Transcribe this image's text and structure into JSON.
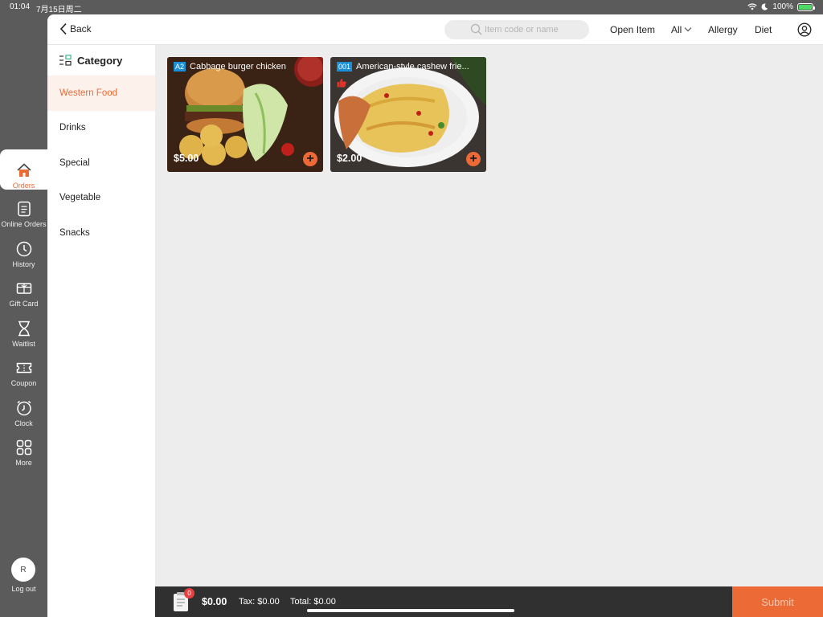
{
  "status_bar": {
    "time": "01:04",
    "date": "7月15日周二",
    "battery": "100%",
    "battery_level": 1.0
  },
  "rail": {
    "items": [
      {
        "label": "Orders",
        "icon": "house-icon",
        "active": true
      },
      {
        "label": "Online Orders",
        "icon": "document-icon"
      },
      {
        "label": "History",
        "icon": "clock-icon"
      },
      {
        "label": "Gift Card",
        "icon": "gift-card-icon"
      },
      {
        "label": "Waitlist",
        "icon": "hourglass-icon"
      },
      {
        "label": "Coupon",
        "icon": "ticket-icon"
      },
      {
        "label": "Clock",
        "icon": "alarm-icon"
      },
      {
        "label": "More",
        "icon": "grid-icon"
      }
    ],
    "avatar_initial": "R",
    "logout_label": "Log out"
  },
  "topbar": {
    "back_label": "Back",
    "search_placeholder": "Item code or name",
    "open_item": "Open Item",
    "filter_value": "All",
    "allergy": "Allergy",
    "diet": "Diet"
  },
  "categories": {
    "header": "Category",
    "items": [
      "Western Food",
      "Drinks",
      "Special",
      "Vegetable",
      "Snacks"
    ],
    "active_index": 0
  },
  "menu_items": [
    {
      "code": "A2",
      "name": "Cabbage burger chicken",
      "price": "$5.00"
    },
    {
      "code": "001",
      "name": "American-style cashew frie...",
      "price": "$2.00",
      "recommended": true
    }
  ],
  "bottom_bar": {
    "cart_count": "0",
    "amount": "$0.00",
    "tax": "Tax: $0.00",
    "total": "Total: $0.00",
    "submit": "Submit"
  },
  "colors": {
    "accent": "#ec6a35",
    "rail_bg": "#5b5b5b",
    "code_badge": "#1a8fd6"
  }
}
